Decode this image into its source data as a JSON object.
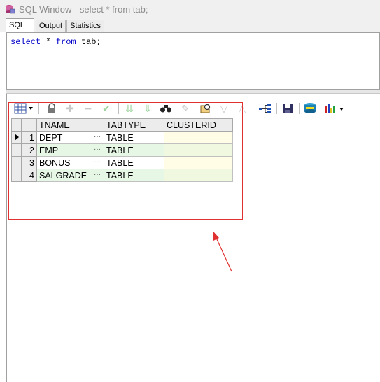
{
  "window": {
    "title": "SQL Window - select * from tab;"
  },
  "tabs": [
    {
      "label": "SQL",
      "active": true
    },
    {
      "label": "Output",
      "active": false
    },
    {
      "label": "Statistics",
      "active": false
    }
  ],
  "editor": {
    "sql_keyword_select": "select",
    "sql_star": " * ",
    "sql_keyword_from": "from",
    "sql_rest": " tab;"
  },
  "toolbar": {
    "icons": [
      "grid-options-icon",
      "lock-icon",
      "insert-record-icon",
      "delete-record-icon",
      "post-changes-icon",
      "fetch-next-icon",
      "fetch-last-icon",
      "find-icon",
      "clear-icon",
      "query-by-example-icon",
      "filter-icon",
      "clear-filter-icon",
      "export-tree-icon",
      "save-icon",
      "print-icon",
      "chart-icon"
    ]
  },
  "grid": {
    "columns": [
      "TNAME",
      "TABTYPE",
      "CLUSTERID"
    ],
    "rows": [
      {
        "num": "1",
        "tname": "DEPT",
        "tabtype": "TABLE",
        "clusterid": ""
      },
      {
        "num": "2",
        "tname": "EMP",
        "tabtype": "TABLE",
        "clusterid": ""
      },
      {
        "num": "3",
        "tname": "BONUS",
        "tabtype": "TABLE",
        "clusterid": ""
      },
      {
        "num": "4",
        "tname": "SALGRADE",
        "tabtype": "TABLE",
        "clusterid": ""
      }
    ],
    "ellipsis": "···"
  },
  "colors": {
    "annotation": "#e03030",
    "keyword": "#0000c8",
    "row_alt": "#e6f7e6"
  }
}
